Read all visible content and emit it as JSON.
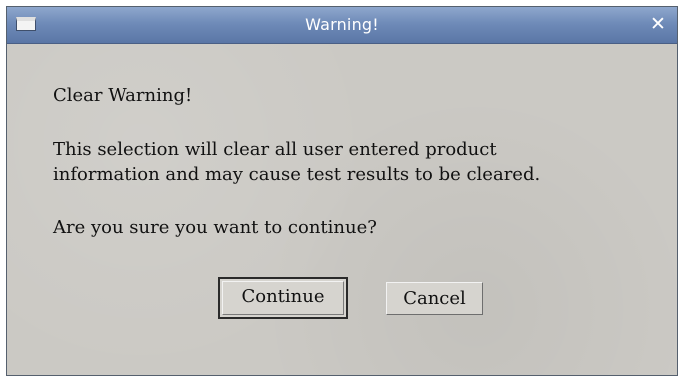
{
  "window": {
    "title": "Warning!",
    "close_symbol": "✕",
    "icon": "window-menu-icon"
  },
  "message": {
    "heading": "Clear Warning!",
    "line1": "This selection will clear all user entered product",
    "line2": "information and may cause test results to be cleared.",
    "question": "Are you sure you want to continue?"
  },
  "buttons": {
    "continue_label": "Continue",
    "cancel_label": "Cancel"
  },
  "colors": {
    "titlebar": "#6f8bb8",
    "dialog_background": "#cbc9c4",
    "text": "#111111"
  }
}
